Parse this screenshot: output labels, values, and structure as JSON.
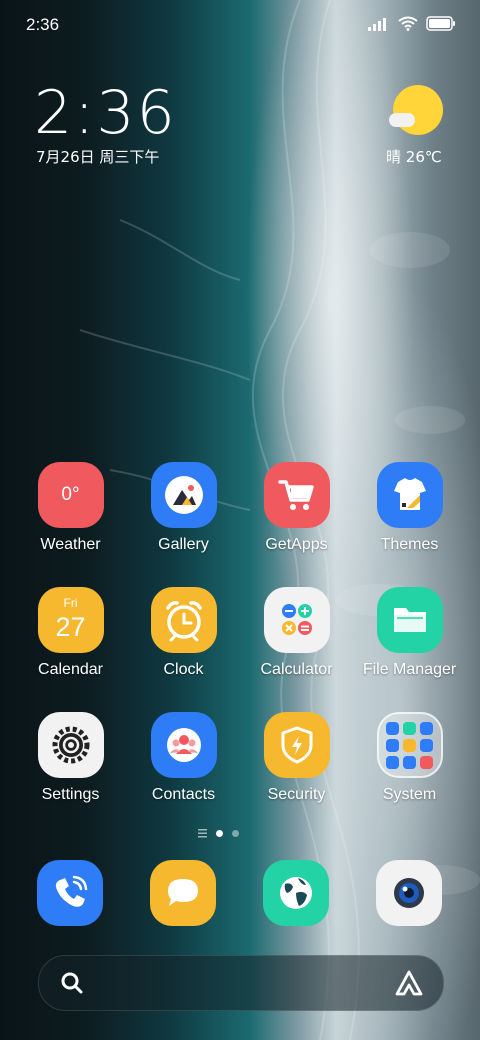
{
  "status_bar": {
    "time": "2:36"
  },
  "clock_widget": {
    "time": "2:36",
    "date": "7月26日 周三下午"
  },
  "weather_widget": {
    "condition": "晴",
    "temperature": "26℃",
    "icon": "sunny-partly-cloudy-icon"
  },
  "apps": [
    {
      "label": "Weather",
      "tile_text": "0°",
      "color": "#f05a5e",
      "icon": "weather-icon"
    },
    {
      "label": "Gallery",
      "color": "#2e7cf6",
      "icon": "gallery-icon"
    },
    {
      "label": "GetApps",
      "color": "#f05a5e",
      "icon": "shopping-cart-icon"
    },
    {
      "label": "Themes",
      "color": "#2e7cf6",
      "icon": "tshirt-icon"
    },
    {
      "label": "Calendar",
      "tile_day": "Fri",
      "tile_date": "27",
      "color": "#f5b82e",
      "icon": "calendar-icon"
    },
    {
      "label": "Clock",
      "color": "#f5b82e",
      "icon": "alarm-clock-icon"
    },
    {
      "label": "Calculator",
      "color": "#f2f2f2",
      "icon": "calculator-icon"
    },
    {
      "label": "File Manager",
      "color": "#23d3a6",
      "icon": "folder-icon"
    },
    {
      "label": "Settings",
      "color": "#f2f2f2",
      "icon": "gear-icon"
    },
    {
      "label": "Contacts",
      "color": "#2e7cf6",
      "icon": "contacts-icon"
    },
    {
      "label": "Security",
      "color": "#f5b82e",
      "icon": "shield-icon"
    },
    {
      "label": "System",
      "color": "folder",
      "icon": "folder-grid-icon"
    }
  ],
  "dock": [
    {
      "icon": "phone-icon",
      "color": "#2e7cf6"
    },
    {
      "icon": "messages-icon",
      "color": "#f5b82e"
    },
    {
      "icon": "browser-globe-icon",
      "color": "#23d3a6"
    },
    {
      "icon": "camera-icon",
      "color": "#f2f2f2"
    }
  ],
  "search_bar": {
    "left_icon": "search-icon",
    "right_icon": "assistant-icon"
  }
}
